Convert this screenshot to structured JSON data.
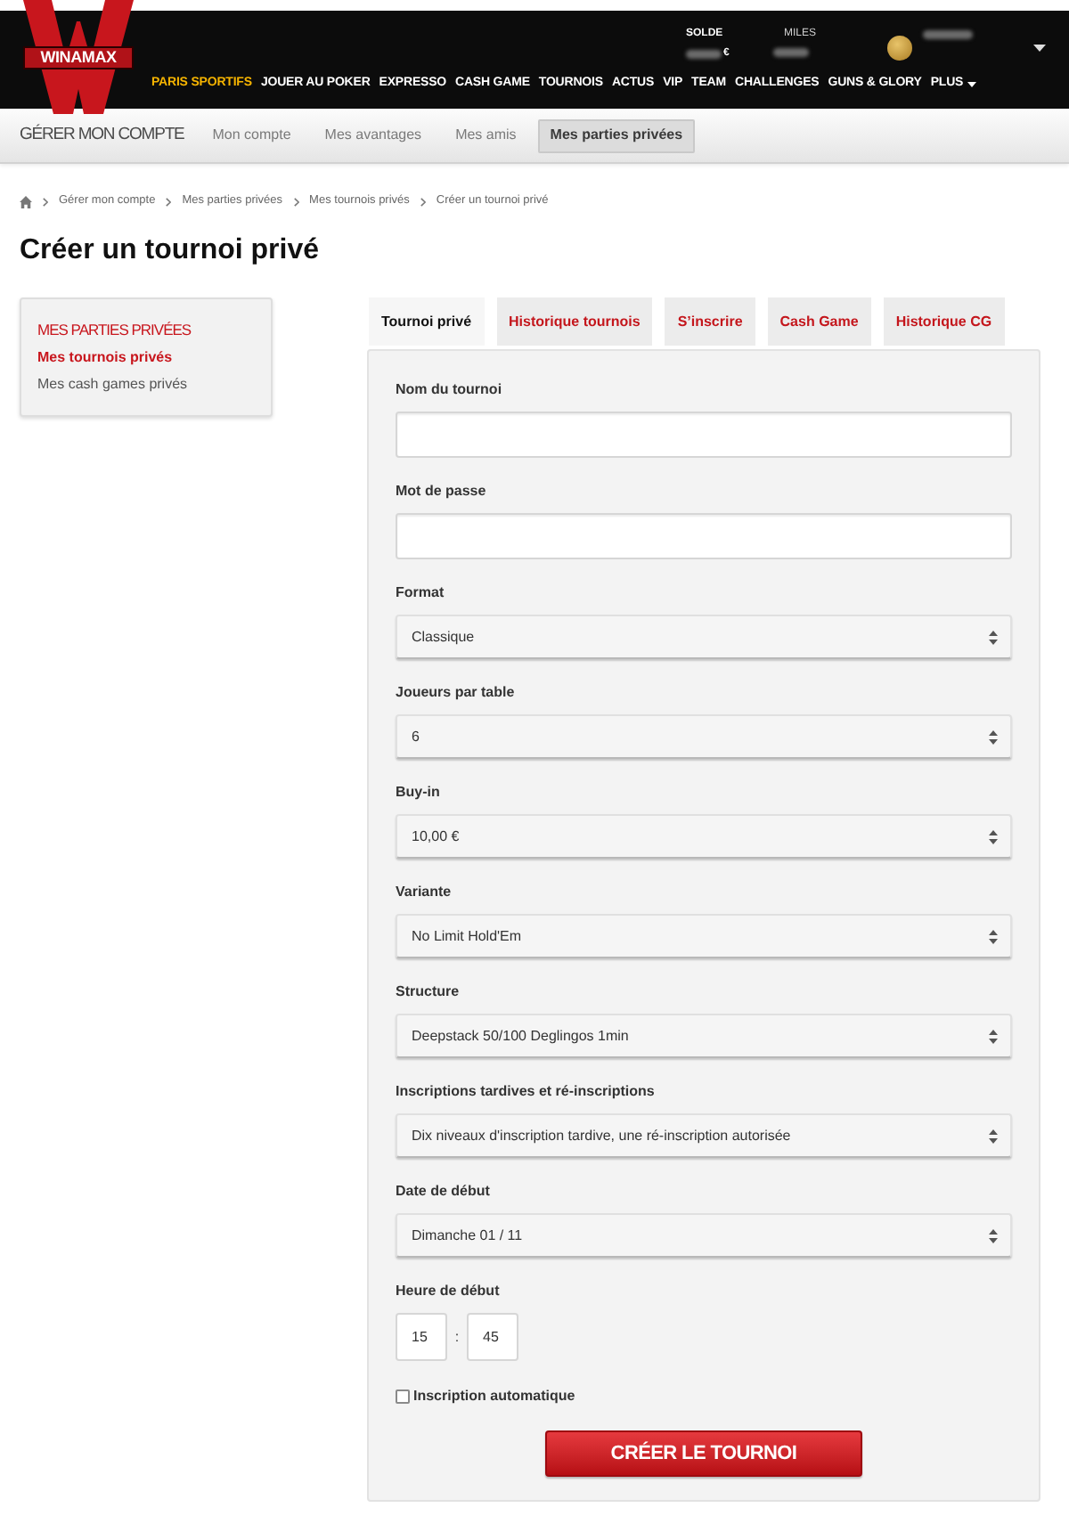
{
  "header": {
    "logo_text": "WINAMAX",
    "balance_label": "SOLDE",
    "balance_currency": "€",
    "miles_label": "MILES"
  },
  "main_nav": [
    {
      "label": "PARIS SPORTIFS",
      "kind": "featured"
    },
    {
      "label": "JOUER AU POKER",
      "kind": "link"
    },
    {
      "label": "EXPRESSO",
      "kind": "link"
    },
    {
      "label": "CASH GAME",
      "kind": "link"
    },
    {
      "label": "TOURNOIS",
      "kind": "link"
    },
    {
      "label": "ACTUS",
      "kind": "link"
    },
    {
      "label": "VIP",
      "kind": "link"
    },
    {
      "label": "TEAM",
      "kind": "link"
    },
    {
      "label": "CHALLENGES",
      "kind": "link"
    },
    {
      "label": "GUNS & GLORY",
      "kind": "link"
    },
    {
      "label": "PLUS",
      "kind": "menu"
    }
  ],
  "account_nav": {
    "title": "GÉRER MON COMPTE",
    "tabs": [
      {
        "label": "Mon compte",
        "selected": false
      },
      {
        "label": "Mes avantages",
        "selected": false
      },
      {
        "label": "Mes amis",
        "selected": false
      },
      {
        "label": "Mes parties privées",
        "selected": true
      }
    ]
  },
  "breadcrumb": [
    "Gérer mon compte",
    "Mes parties privées",
    "Mes tournois privés",
    "Créer un tournoi privé"
  ],
  "page_title": "Créer un tournoi privé",
  "sidebar": {
    "title": "MES PARTIES PRIVÉES",
    "items": [
      {
        "label": "Mes tournois privés",
        "selected": true
      },
      {
        "label": "Mes cash games privés",
        "selected": false
      }
    ]
  },
  "tabs": [
    {
      "label": "Tournoi privé",
      "selected": true
    },
    {
      "label": "Historique tournois",
      "selected": false
    },
    {
      "label": "S’inscrire",
      "selected": false
    },
    {
      "label": "Cash Game",
      "selected": false
    },
    {
      "label": "Historique CG",
      "selected": false
    }
  ],
  "form": {
    "fields": [
      {
        "kind": "text",
        "label": "Nom du tournoi"
      },
      {
        "kind": "text",
        "label": "Mot de passe"
      },
      {
        "kind": "select",
        "label": "Format",
        "value": "Classique"
      },
      {
        "kind": "select",
        "label": "Joueurs par table",
        "value": "6"
      },
      {
        "kind": "select",
        "label": "Buy-in",
        "value": "10,00 €"
      },
      {
        "kind": "select",
        "label": "Variante",
        "value": "No Limit Hold'Em"
      },
      {
        "kind": "select",
        "label": "Structure",
        "value": "Deepstack 50/100 Deglingos 1min"
      },
      {
        "kind": "select",
        "label": "Inscriptions tardives et ré-inscriptions",
        "value": "Dix niveaux d'inscription tardive, une ré-inscription autorisée"
      },
      {
        "kind": "select",
        "label": "Date de début",
        "value": "Dimanche 01 / 11"
      },
      {
        "kind": "time",
        "label": "Heure de début",
        "hour": "15",
        "separator": ":",
        "minute": "45"
      }
    ],
    "auto_register": {
      "label": "Inscription automatique",
      "checked": false
    },
    "submit_label": "CRÉER LE TOURNOI"
  }
}
